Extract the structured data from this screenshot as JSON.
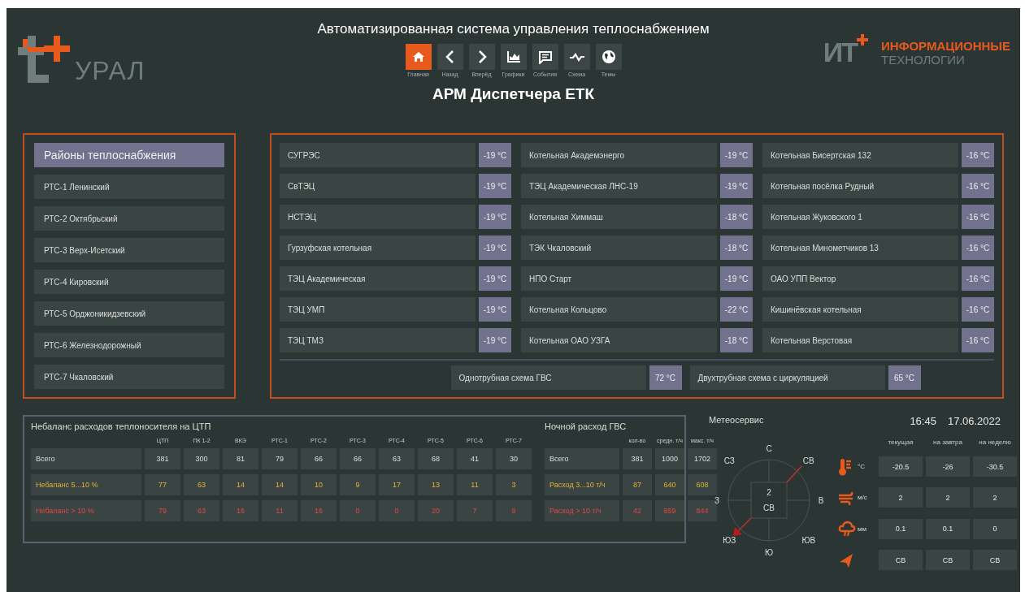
{
  "header": {
    "logo_left": "УРАЛ",
    "title": "Автоматизированная система управления теплоснабжением",
    "logo_right": [
      "ИНФОРМАЦИОННЫЕ",
      "ТЕХНОЛОГИИ"
    ],
    "logo_right_mark": "ИТ",
    "subtitle": "АРМ Диспетчера ЕТК"
  },
  "nav": [
    {
      "label": "Главная",
      "selected": true
    },
    {
      "label": "Назад",
      "selected": false
    },
    {
      "label": "Вперёд",
      "selected": false
    },
    {
      "label": "Графики",
      "selected": false
    },
    {
      "label": "События",
      "selected": false
    },
    {
      "label": "Схема",
      "selected": false
    },
    {
      "label": "Темы",
      "selected": false
    }
  ],
  "districts": {
    "title": "Районы теплоснабжения",
    "items": [
      "РТС-1 Ленинский",
      "РТС-2 Октябрьский",
      "РТС-3 Верх-Исетский",
      "РТС-4 Кировский",
      "РТС-5 Орджоникидзевский",
      "РТС-6 Железнодорожный",
      "РТС-7 Чкаловский"
    ]
  },
  "sources": [
    [
      {
        "name": "СУГРЭС",
        "temp": "-19 °C"
      },
      {
        "name": "СвТЭЦ",
        "temp": "-19 °C"
      },
      {
        "name": "НСТЭЦ",
        "temp": "-19 °C"
      },
      {
        "name": "Гурзуфская котельная",
        "temp": "-19 °C"
      },
      {
        "name": "ТЭЦ Академическая",
        "temp": "-19 °C"
      },
      {
        "name": "ТЭЦ УМП",
        "temp": "-19 °C"
      },
      {
        "name": "ТЭЦ ТМЗ",
        "temp": "-19 °C"
      }
    ],
    [
      {
        "name": "Котельная Академэнерго",
        "temp": "-19 °C"
      },
      {
        "name": "ТЭЦ Академическая ЛНС-19",
        "temp": "-19 °C"
      },
      {
        "name": "Котельная Химмаш",
        "temp": "-18 °C"
      },
      {
        "name": "ТЭК Чкаловский",
        "temp": "-18 °C"
      },
      {
        "name": "НПО Старт",
        "temp": "-19 °C"
      },
      {
        "name": "Котельная Кольцово",
        "temp": "-22 °C"
      },
      {
        "name": "Котельная ОАО УЗГА",
        "temp": "-18 °C"
      }
    ],
    [
      {
        "name": "Котельная Бисертская 132",
        "temp": "-16 °C"
      },
      {
        "name": "Котельная посёлка Рудный",
        "temp": "-16 °C"
      },
      {
        "name": "Котельная Жуковского 1",
        "temp": "-16 °C"
      },
      {
        "name": "Котельная Минометчиков 13",
        "temp": "-16 °C"
      },
      {
        "name": "ОАО УПП Вектор",
        "temp": "-16 °C"
      },
      {
        "name": "Кишинёвская котельная",
        "temp": "-16 °C"
      },
      {
        "name": "Котельная Верстовая",
        "temp": "-16 °C"
      }
    ]
  ],
  "schemes": [
    {
      "name": "Однотрубная схема ГВС",
      "temp": "72 °C"
    },
    {
      "name": "Двухтрубная схема с циркуляцией",
      "temp": "65 °C"
    }
  ],
  "imbalance": {
    "title": "Небаланс расходов теплоносителя на ЦТП",
    "columns": [
      "ЦТП",
      "ПК 1-2",
      "ВКЭ",
      "РТС-1",
      "РТС-2",
      "РТС-3",
      "РТС-4",
      "РТС-5",
      "РТС-6",
      "РТС-7"
    ],
    "rows": [
      {
        "kind": "total",
        "label": "Всего",
        "values": [
          "381",
          "300",
          "81",
          "79",
          "66",
          "66",
          "63",
          "68",
          "41",
          "30"
        ]
      },
      {
        "kind": "warn",
        "label": "Небаланс 5...10 %",
        "values": [
          "77",
          "63",
          "14",
          "14",
          "10",
          "9",
          "17",
          "13",
          "11",
          "3"
        ]
      },
      {
        "kind": "alarm",
        "label": "Небаланс > 10 %",
        "values": [
          "79",
          "63",
          "16",
          "11",
          "16",
          "0",
          "0",
          "20",
          "7",
          "9"
        ]
      }
    ]
  },
  "night": {
    "title": "Ночной расход ГВС",
    "columns": [
      "кол-во",
      "средн. т/ч",
      "макс. т/ч"
    ],
    "rows": [
      {
        "kind": "total",
        "label": "Всего",
        "values": [
          "381",
          "1000",
          "1702"
        ]
      },
      {
        "kind": "warn",
        "label": "Расход 3...10 т/ч",
        "values": [
          "87",
          "640",
          "608"
        ]
      },
      {
        "kind": "alarm",
        "label": "Расход > 10 т/ч",
        "values": [
          "42",
          "859",
          "844"
        ]
      }
    ]
  },
  "weather": {
    "title": "Метеосервис",
    "time": "16:45",
    "date": "17.06.2022",
    "compass": {
      "directions": [
        "С",
        "СВ",
        "В",
        "ЮВ",
        "Ю",
        "ЮЗ",
        "З",
        "СЗ"
      ],
      "speed": "2",
      "direction": "СВ"
    },
    "columns": [
      "текущая",
      "на завтра",
      "на неделю"
    ],
    "rows": [
      {
        "unit": "°C",
        "values": [
          "-20.5",
          "-26",
          "-30.5"
        ]
      },
      {
        "unit": "м/с",
        "values": [
          "2",
          "2",
          "2"
        ]
      },
      {
        "unit": "мм",
        "values": [
          "0.1",
          "0.1",
          "0"
        ]
      },
      {
        "values": [
          "СВ",
          "СВ",
          "СВ"
        ]
      }
    ]
  }
}
